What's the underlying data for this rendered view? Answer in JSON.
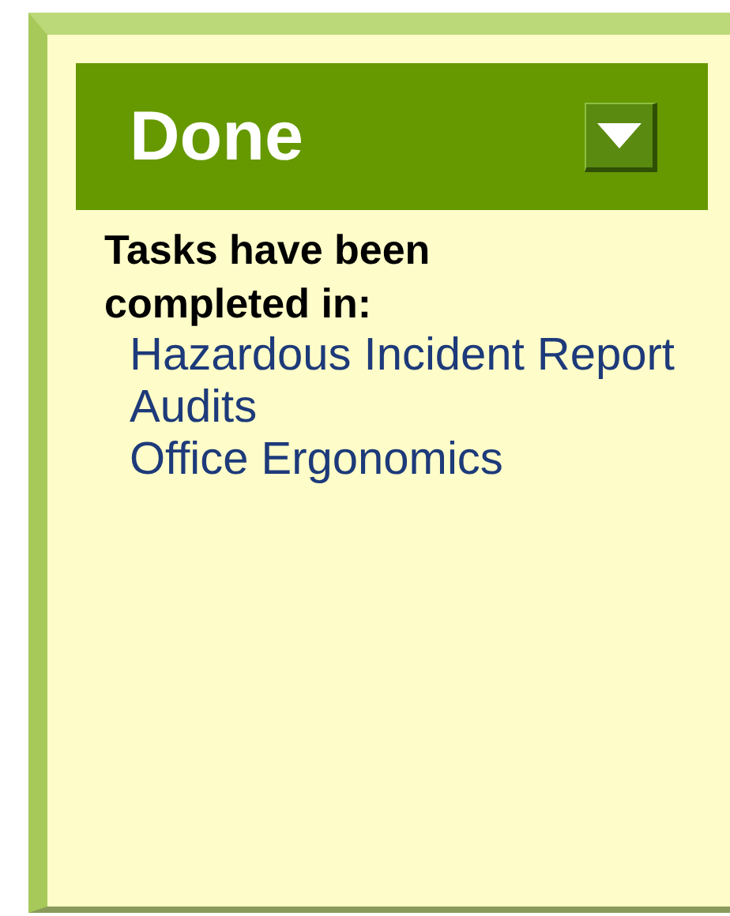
{
  "panel": {
    "title": "Done",
    "description": "Tasks have been completed in:",
    "links": [
      "Hazardous Incident Report",
      "Audits",
      "Office Ergonomics"
    ]
  }
}
